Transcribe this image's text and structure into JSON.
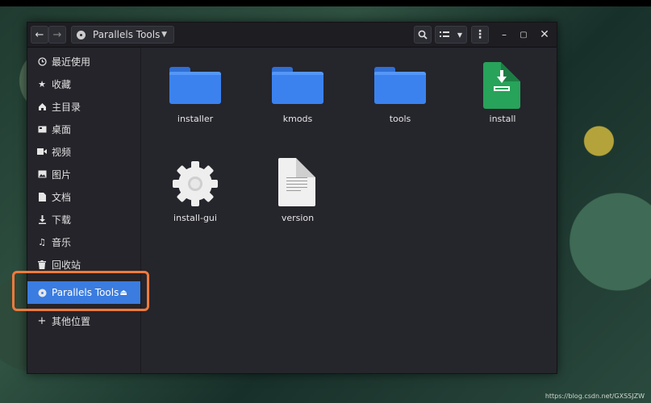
{
  "window": {
    "path_label": "Parallels Tools"
  },
  "sidebar": {
    "items": [
      {
        "label": "最近使用",
        "icon": "clock-icon"
      },
      {
        "label": "收藏",
        "icon": "star-icon"
      },
      {
        "label": "主目录",
        "icon": "home-icon"
      },
      {
        "label": "桌面",
        "icon": "desktop-icon"
      },
      {
        "label": "视频",
        "icon": "video-icon"
      },
      {
        "label": "图片",
        "icon": "image-icon"
      },
      {
        "label": "文档",
        "icon": "document-icon"
      },
      {
        "label": "下载",
        "icon": "download-icon"
      },
      {
        "label": "音乐",
        "icon": "music-icon"
      },
      {
        "label": "回收站",
        "icon": "trash-icon"
      }
    ],
    "active_item": {
      "label": "Parallels Tools",
      "icon": "disc-icon",
      "eject_icon": "eject-icon"
    },
    "other_locations": {
      "label": "其他位置",
      "icon": "plus-icon"
    }
  },
  "files": [
    {
      "name": "installer",
      "type": "folder"
    },
    {
      "name": "kmods",
      "type": "folder"
    },
    {
      "name": "tools",
      "type": "folder"
    },
    {
      "name": "install",
      "type": "package"
    },
    {
      "name": "install-gui",
      "type": "executable"
    },
    {
      "name": "version",
      "type": "text-document"
    }
  ],
  "colors": {
    "accent": "#3a7ce0",
    "highlight_box": "#f07a3c",
    "folder": "#3b82ef",
    "package": "#27a35a"
  },
  "watermark": "https://blog.csdn.net/GXSSJZW"
}
